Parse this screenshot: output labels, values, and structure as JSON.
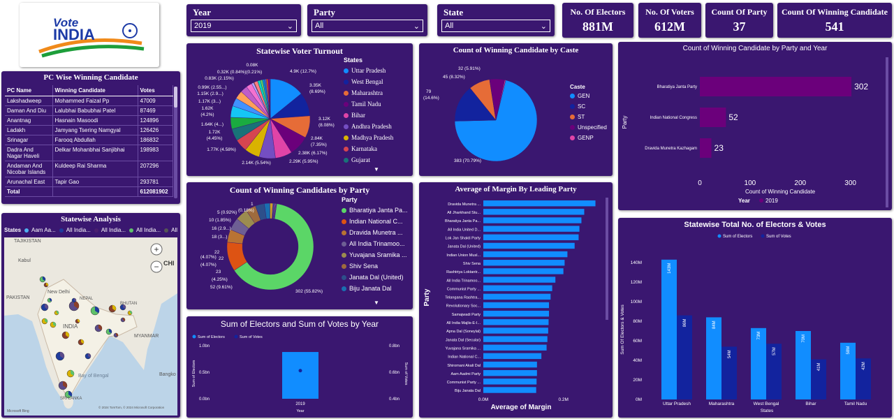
{
  "logo": {
    "line1": "Vote",
    "line2": "INDIA"
  },
  "filters": {
    "year": {
      "label": "Year",
      "value": "2019"
    },
    "party": {
      "label": "Party",
      "value": "All"
    },
    "state": {
      "label": "State",
      "value": "All"
    }
  },
  "kpis": [
    {
      "label": "No. Of Electors",
      "value": "881M"
    },
    {
      "label": "No. Of Voters",
      "value": "612M"
    },
    {
      "label": "Count Of Party",
      "value": "37"
    },
    {
      "label": "Count Of Winning Candidate",
      "value": "541"
    }
  ],
  "pc_table": {
    "title": "PC Wise Winning Candidate",
    "columns": [
      "PC Name",
      "Winning Candidate",
      "Votes"
    ],
    "rows": [
      [
        "Lakshadweep",
        "Mohammed Faizal Pp",
        "47009"
      ],
      [
        "Daman And Diu",
        "Lalubhai Babubhai Patel",
        "87469"
      ],
      [
        "Anantnag",
        "Hasnain Masoodi",
        "124896"
      ],
      [
        "Ladakh",
        "Jamyang Tsering Namgyal",
        "126426"
      ],
      [
        "Srinagar",
        "Farooq Abdullah",
        "186832"
      ],
      [
        "Dadra And Nagar Haveli",
        "Delkar Mohanbhai Sanjibhai",
        "198983"
      ],
      [
        "Andaman And Nicobar Islands",
        "Kuldeep Rai Sharma",
        "207296"
      ],
      [
        "Arunachal East",
        "Tapir Gao",
        "293781"
      ]
    ],
    "total_label": "Total",
    "total_value": "612081902"
  },
  "statewise_analysis": {
    "title": "Statewise Analysis",
    "legend_label": "States",
    "legend_items": [
      {
        "label": "Aam Aa...",
        "color": "#4fb0f0"
      },
      {
        "label": "All India...",
        "color": "#1f3c9c"
      },
      {
        "label": "All India...",
        "color": "#4a1f6f"
      },
      {
        "label": "All India...",
        "color": "#5fc16a"
      },
      {
        "label": "All India...",
        "color": "#555555"
      }
    ],
    "map_labels": [
      {
        "text": "TAJIKISTAN"
      },
      {
        "text": "Kabul"
      },
      {
        "text": "PAKISTAN"
      },
      {
        "text": "New Delhi"
      },
      {
        "text": "NEPAL"
      },
      {
        "text": "BHUTAN"
      },
      {
        "text": "INDIA"
      },
      {
        "text": "MYANMAR"
      },
      {
        "text": "Bay of Bengal"
      },
      {
        "text": "SRI LANKA"
      },
      {
        "text": "CHI"
      },
      {
        "text": "Bangko"
      }
    ],
    "zoom_in": "+",
    "zoom_out": "−",
    "attribution": "© 2024 TomTom, © 2024 Microsoft Corporation",
    "brand": "Microsoft Bing"
  },
  "turnout": {
    "title": "Statewise Voter Turnout",
    "legend_title": "States",
    "legend": [
      {
        "label": "Uttar Pradesh",
        "color": "#118dff"
      },
      {
        "label": "West Bengal",
        "color": "#12239e"
      },
      {
        "label": "Maharashtra",
        "color": "#e66c37"
      },
      {
        "label": "Tamil Nadu",
        "color": "#6b007b"
      },
      {
        "label": "Bihar",
        "color": "#e044a7"
      },
      {
        "label": "Andhra Pradesh",
        "color": "#744ec2"
      },
      {
        "label": "Madhya Pradesh",
        "color": "#d9b300"
      },
      {
        "label": "Karnataka",
        "color": "#d64550"
      },
      {
        "label": "Gujarat",
        "color": "#197278"
      }
    ],
    "slices": [
      4.9,
      3.35,
      3.12,
      2.84,
      2.38,
      2.29,
      2.14,
      1.77,
      1.72,
      1.64,
      1.62,
      1.17,
      1.15,
      0.99,
      0.83,
      0.32,
      0.08,
      0.5,
      0.4,
      0.3,
      0.3,
      0.25,
      0.2,
      0.15,
      0.1,
      0.1
    ],
    "slice_colors": [
      "#118dff",
      "#12239e",
      "#e66c37",
      "#6b007b",
      "#e044a7",
      "#744ec2",
      "#d9b300",
      "#d64550",
      "#197278",
      "#1aab40",
      "#15c6f4",
      "#4092ff",
      "#ffa058",
      "#be5dc9",
      "#f472d0",
      "#b5a1ff",
      "#c4a200",
      "#ff8080",
      "#00dbbc",
      "#5bd667",
      "#0091d5",
      "#4668c5",
      "#ff6300",
      "#99008a",
      "#ec008c",
      "#533285"
    ],
    "labels": [
      {
        "text": "4.9K (12.7%)"
      },
      {
        "text": "3.35K"
      },
      {
        "text": "(8.69%)"
      },
      {
        "text": "3.12K"
      },
      {
        "text": "(8.08%)"
      },
      {
        "text": "2.84K"
      },
      {
        "text": "(7.35%)"
      },
      {
        "text": "2.38K (6.17%)"
      },
      {
        "text": "2.29K (5.95%)"
      },
      {
        "text": "2.14K (5.54%)"
      },
      {
        "text": "1.77K (4.58%)"
      },
      {
        "text": "1.72K"
      },
      {
        "text": "(4.45%)"
      },
      {
        "text": "1.64K (4...)"
      },
      {
        "text": "1.62K"
      },
      {
        "text": "(4.2%)"
      },
      {
        "text": "1.17K (3...)"
      },
      {
        "text": "1.15K (2.9...)"
      },
      {
        "text": "0.99K (2.55...)"
      },
      {
        "text": "0.83K (2.15%)"
      },
      {
        "text": "0.32K (0.84%)(0.21%)"
      },
      {
        "text": "0.08K"
      }
    ]
  },
  "caste": {
    "title": "Count of Winning Candidate by Caste",
    "legend_title": "Caste",
    "legend": [
      {
        "label": "GEN",
        "color": "#118dff"
      },
      {
        "label": "SC",
        "color": "#12239e"
      },
      {
        "label": "ST",
        "color": "#e66c37"
      },
      {
        "label": "Unspecified",
        "color": "#6b007b"
      },
      {
        "label": "GENP",
        "color": "#e044a7"
      }
    ],
    "values": [
      383,
      79,
      45,
      32,
      2
    ],
    "labels": [
      {
        "text": "383 (70.79%)"
      },
      {
        "text": "79"
      },
      {
        "text": "(14.6%)"
      },
      {
        "text": "45 (8.32%)"
      },
      {
        "text": "32 (5.91%)"
      }
    ]
  },
  "party_year": {
    "title": "Count of Winning Candidate by Party and Year",
    "ylabel": "Party",
    "xlabel": "Count of Winning Candidate",
    "legend_title": "Year",
    "legend_value": "2019",
    "bar_color": "#6b007b",
    "bars": [
      {
        "label": "Bharatiya Janta Party",
        "value": 302
      },
      {
        "label": "Indian National Congress",
        "value": 52
      },
      {
        "label": "Dravida Munetra Kazhagam",
        "value": 23
      }
    ],
    "ticks": [
      "0",
      "100",
      "200",
      "300"
    ],
    "xmax": 320
  },
  "party_donut": {
    "title": "Count of Winning Candidates by Party",
    "legend_title": "Party",
    "legend": [
      {
        "label": "Bharatiya Janta Pa...",
        "color": "#5bd667"
      },
      {
        "label": "Indian National C...",
        "color": "#dd5313"
      },
      {
        "label": "Dravida Munetra ...",
        "color": "#b87333"
      },
      {
        "label": "All India Trinamoo...",
        "color": "#6e5f94"
      },
      {
        "label": "Yuvajana Sramika ...",
        "color": "#9c8c4f"
      },
      {
        "label": "Shiv Sena",
        "color": "#9e6b3d"
      },
      {
        "label": "Janata Dal (United)",
        "color": "#2d4f8a"
      },
      {
        "label": "Biju Janata Dal",
        "color": "#1a6fb0"
      }
    ],
    "values": [
      302,
      52,
      23,
      22,
      22,
      18,
      16,
      10,
      5,
      1,
      1,
      1,
      1,
      1,
      1,
      1
    ],
    "colors": [
      "#5bd667",
      "#dd5313",
      "#b87333",
      "#6e5f94",
      "#9c8c4f",
      "#9e6b3d",
      "#2d4f8a",
      "#1a6fb0",
      "#c9a227",
      "#ff8080",
      "#00dbbc",
      "#e044a7",
      "#15c6f4",
      "#ffa058",
      "#be5dc9",
      "#744ec2"
    ],
    "labels": [
      {
        "text": "302 (55.82%)"
      },
      {
        "text": "52 (9.61%)"
      },
      {
        "text": "23"
      },
      {
        "text": "(4.25%)"
      },
      {
        "text": "22"
      },
      {
        "text": "(4.07%)"
      },
      {
        "text": "22"
      },
      {
        "text": "(4.07%)"
      },
      {
        "text": "18 (3...)"
      },
      {
        "text": "16 (2.9...)"
      },
      {
        "text": "10 (1.85%)"
      },
      {
        "text": "5 (0.92%)"
      },
      {
        "text": "1"
      },
      {
        "text": "(0.18%)"
      }
    ]
  },
  "margin": {
    "title": "Average of Margin By Leading Party",
    "ylabel": "Party",
    "xlabel": "Average of Margin",
    "ticks": [
      "0.0M",
      "0.2M"
    ],
    "bar_color": "#118dff",
    "bars": [
      {
        "label": "Dravida Munetra ...",
        "value": 0.28
      },
      {
        "label": "All Jharkhand Stu...",
        "value": 0.252
      },
      {
        "label": "Bharatiya Janta Pa...",
        "value": 0.245
      },
      {
        "label": "All India United D...",
        "value": 0.24
      },
      {
        "label": "Lok Jan Shakti Party",
        "value": 0.238
      },
      {
        "label": "Janata Dal (United)",
        "value": 0.228
      },
      {
        "label": "Indian Union Musl...",
        "value": 0.21
      },
      {
        "label": "Shiv Sena",
        "value": 0.203
      },
      {
        "label": "Rashtriya Loktantr...",
        "value": 0.2
      },
      {
        "label": "All India Trinamoo...",
        "value": 0.18
      },
      {
        "label": "Communist Party ...",
        "value": 0.172
      },
      {
        "label": "Telangana Rashtra...",
        "value": 0.168
      },
      {
        "label": "Revolutionary Soc...",
        "value": 0.164
      },
      {
        "label": "Samajwadi Party",
        "value": 0.164
      },
      {
        "label": "All India Majlis-E-I...",
        "value": 0.163
      },
      {
        "label": "Apna Dal (Soneylal)",
        "value": 0.162
      },
      {
        "label": "Janata Dal (Secular)",
        "value": 0.16
      },
      {
        "label": "Yuvajana Sramika ...",
        "value": 0.158
      },
      {
        "label": "Indian National C...",
        "value": 0.145
      },
      {
        "label": "Shiromani Akali Dal",
        "value": 0.134
      },
      {
        "label": "Aam Aadmi Party",
        "value": 0.134
      },
      {
        "label": "Communist Party ...",
        "value": 0.133
      },
      {
        "label": "Biju Janata Dal",
        "value": 0.132
      }
    ],
    "xmax": 0.3
  },
  "electors_year": {
    "title": "Sum of Electors and Sum of Votes by Year",
    "legend": [
      {
        "label": "Sum of Electors",
        "color": "#118dff"
      },
      {
        "label": "Sum of Votes",
        "color": "#12239e"
      }
    ],
    "ylabel_left": "Sum of Electors",
    "ylabel_right": "Sum of Votes",
    "left_ticks": [
      "1.0bn",
      "0.5bn",
      "0.0bn"
    ],
    "right_ticks": [
      "0.8bn",
      "0.6bn",
      "0.4bn"
    ],
    "category": "2019",
    "xlabel": "Year",
    "electors": 0.881,
    "votes": 0.612
  },
  "state_electors": {
    "title": "Statewise Total No. of Electors & Votes",
    "legend": [
      {
        "label": "Sum of Electors",
        "color": "#118dff"
      },
      {
        "label": "Sum of Votes",
        "color": "#12239e"
      }
    ],
    "ylabel": "Sum Of Electors & Votes",
    "xlabel": "States",
    "ticks": [
      "0M",
      "20M",
      "40M",
      "60M",
      "80M",
      "100M",
      "120M",
      "140M"
    ],
    "ymax": 150,
    "states": [
      {
        "name": "Uttar Pradesh",
        "electors": 143,
        "votes": 86,
        "el_label": "143M",
        "vo_label": "86M"
      },
      {
        "name": "Maharashtra",
        "electors": 84,
        "votes": 54,
        "el_label": "84M",
        "vo_label": "54M"
      },
      {
        "name": "West Bengal",
        "electors": 73,
        "votes": 57,
        "el_label": "73M",
        "vo_label": "57M"
      },
      {
        "name": "Bihar",
        "electors": 70,
        "votes": 41,
        "el_label": "70M",
        "vo_label": "41M"
      },
      {
        "name": "Tamil Nadu",
        "electors": 58,
        "votes": 42,
        "el_label": "58M",
        "vo_label": "42M"
      }
    ]
  }
}
